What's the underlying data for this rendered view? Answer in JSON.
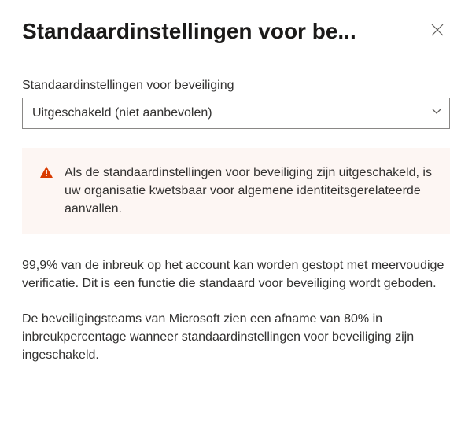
{
  "header": {
    "title": "Standaardinstellingen voor be..."
  },
  "form": {
    "field_label": "Standaardinstellingen voor beveiliging",
    "select_value": "Uitgeschakeld (niet aanbevolen)"
  },
  "warning": {
    "text": "Als de standaardinstellingen voor beveiliging zijn uitgeschakeld, is uw organisatie kwetsbaar voor algemene identiteitsgerelateerde aanvallen."
  },
  "body": {
    "paragraph1": "99,9% van de inbreuk op het account kan worden gestopt met meervoudige verificatie. Dit is een functie die standaard voor beveiliging wordt geboden.",
    "paragraph2": "De beveiligingsteams van Microsoft zien een afname van 80% in inbreukpercentage wanneer standaardinstellingen voor beveiliging zijn ingeschakeld."
  }
}
